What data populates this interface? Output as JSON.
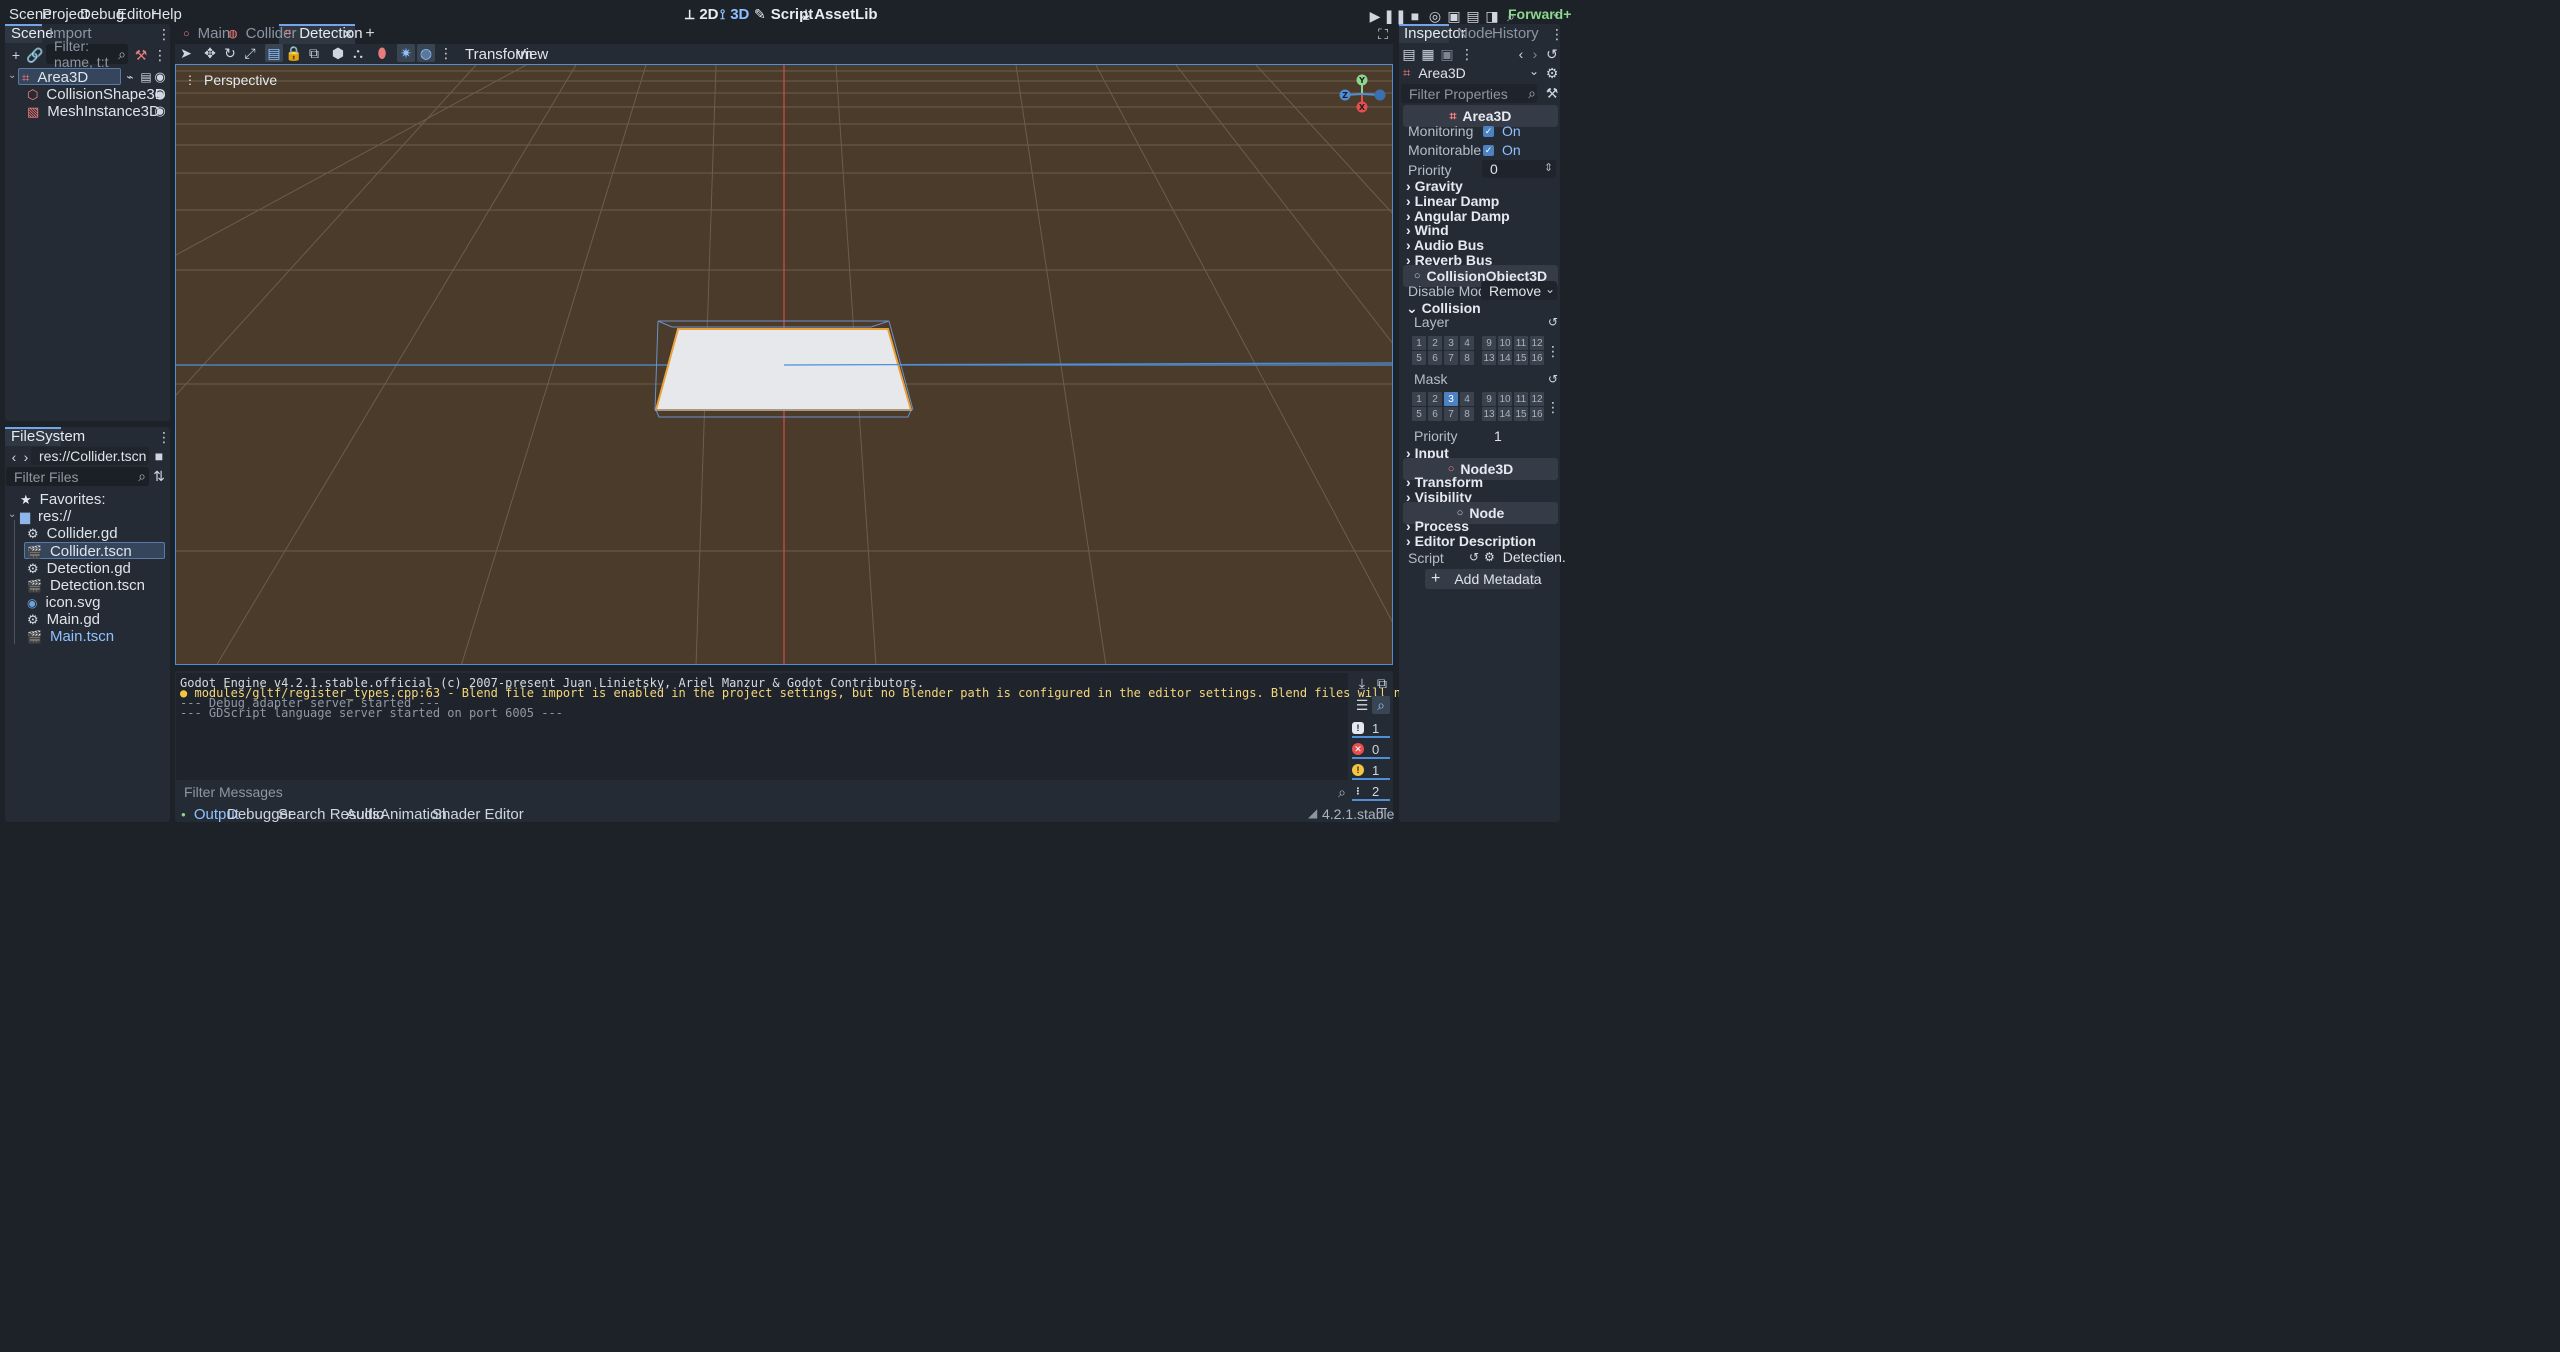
{
  "menu": [
    "Scene",
    "Project",
    "Debug",
    "Editor",
    "Help"
  ],
  "modes": [
    {
      "label": "2D",
      "active": false
    },
    {
      "label": "3D",
      "active": true
    },
    {
      "label": "Script",
      "active": false
    },
    {
      "label": "AssetLib",
      "active": false
    }
  ],
  "renderer": "Forward+",
  "scene_panel": {
    "tabs": [
      "Scene",
      "Import"
    ],
    "filter_placeholder": "Filter: name, t:t",
    "nodes": [
      {
        "label": "Area3D",
        "color": "#fc7f7f"
      },
      {
        "label": "CollisionShape3D",
        "color": "#fc7f7f"
      },
      {
        "label": "MeshInstance3D",
        "color": "#fc7f7f"
      }
    ]
  },
  "filesystem": {
    "tab": "FileSystem",
    "path": "res://Collider.tscn",
    "filter_placeholder": "Filter Files",
    "favorites": "Favorites:",
    "root": "res://",
    "files": [
      {
        "label": "Collider.gd",
        "icon": "gear"
      },
      {
        "label": "Collider.tscn",
        "icon": "clapper",
        "selected": true
      },
      {
        "label": "Detection.gd",
        "icon": "gear"
      },
      {
        "label": "Detection.tscn",
        "icon": "clapper"
      },
      {
        "label": "icon.svg",
        "icon": "image"
      },
      {
        "label": "Main.gd",
        "icon": "gear"
      },
      {
        "label": "Main.tscn",
        "icon": "clapper",
        "highlight": true
      }
    ]
  },
  "scene_tabs": [
    {
      "label": "Main",
      "selected": false
    },
    {
      "label": "Collider",
      "selected": false
    },
    {
      "label": "Detection",
      "selected": true
    }
  ],
  "toolbar": {
    "transform": "Transform",
    "view": "View"
  },
  "viewport": {
    "perspective": "Perspective",
    "gizmo": {
      "y": "Y",
      "x": "X",
      "z": "Z"
    }
  },
  "output": {
    "lines": [
      {
        "text": "Godot Engine v4.2.1.stable.official (c) 2007-present Juan Linietsky, Ariel Manzur & Godot Contributors.",
        "color": "#d6dbe2"
      },
      {
        "text": "modules/gltf/register_types.cpp:63 - Blend file import is enabled in the project settings, but no Blender path is configured in the editor settings. Blend files will not be imported.",
        "color": "#f5d67b"
      },
      {
        "text": "--- Debug adapter server started ---",
        "color": "#8f98a5"
      },
      {
        "text": "--- GDScript language server started on port 6005 ---",
        "color": "#8f98a5"
      }
    ],
    "filter_placeholder": "Filter Messages",
    "counts": {
      "messages": "1",
      "errors": "0",
      "warnings": "1",
      "other": "2"
    }
  },
  "bottom_tabs": [
    "Output",
    "Debugger",
    "Search Results",
    "Audio",
    "Animation",
    "Shader Editor"
  ],
  "version": "4.2.1.stable",
  "inspector": {
    "tabs": [
      "Inspector",
      "Node",
      "History"
    ],
    "node_name": "Area3D",
    "filter_placeholder": "Filter Properties",
    "area_section": "Area3D",
    "monitoring": {
      "label": "Monitoring",
      "value": "On"
    },
    "monitorable": {
      "label": "Monitorable",
      "value": "On"
    },
    "priority": {
      "label": "Priority",
      "value": "0"
    },
    "groups1": [
      "Gravity",
      "Linear Damp",
      "Angular Damp",
      "Wind",
      "Audio Bus",
      "Reverb Bus"
    ],
    "collision_section": "CollisionObject3D",
    "disable_mode": {
      "label": "Disable Mode",
      "value": "Remove"
    },
    "collision_group": "Collision",
    "layer_label": "Layer",
    "mask_label": "Mask",
    "layer_active": [],
    "mask_active": [
      "3"
    ],
    "grid_row1": [
      "1",
      "2",
      "3",
      "4",
      "9",
      "10",
      "11",
      "12"
    ],
    "grid_row2": [
      "5",
      "6",
      "7",
      "8",
      "13",
      "14",
      "15",
      "16"
    ],
    "collision_priority": {
      "label": "Priority",
      "value": "1"
    },
    "input_group": "Input",
    "node3d_section": "Node3D",
    "groups2": [
      "Transform",
      "Visibility"
    ],
    "node_section": "Node",
    "groups3": [
      "Process",
      "Editor Description"
    ],
    "script": {
      "label": "Script",
      "value": "Detection."
    },
    "add_metadata": "Add Metadata"
  }
}
